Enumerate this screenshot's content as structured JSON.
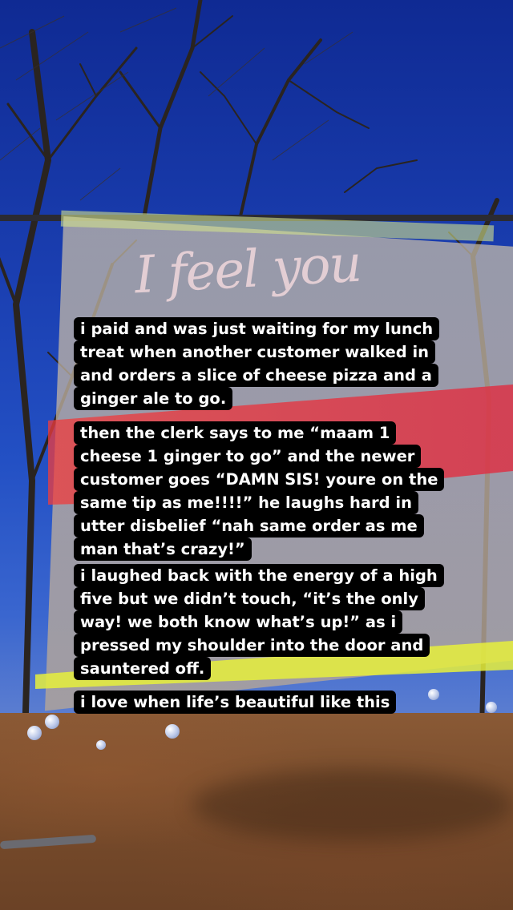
{
  "scene": {
    "description_icons": [
      "tree-silhouette",
      "fabric-banner",
      "glass-bead"
    ],
    "colors": {
      "sky": "#1a3eb0",
      "ground": "#7a4d2c",
      "banner_red": "#e03c46",
      "banner_yellow": "#e6f03c",
      "caption_bg": "#000000",
      "caption_text": "#ffffff"
    }
  },
  "banner": {
    "script_text": "I feel you"
  },
  "captions": [
    {
      "lines": [
        "i paid and was just waiting for my lunch",
        "treat when another customer walked in",
        "and orders a slice of cheese pizza and a",
        "ginger ale to go."
      ]
    },
    {
      "lines": [
        "then the clerk says to me “maam 1",
        "cheese 1 ginger to go” and the newer",
        "customer goes “DAMN SIS! youre on the",
        "same tip as me!!!!” he laughs hard in",
        "utter disbelief “nah same order as me",
        "man that’s crazy!”"
      ]
    },
    {
      "lines": [
        "i laughed back with the energy of a high",
        "five but we didn’t touch, “it’s the only",
        "way! we both know what’s up!” as i",
        "pressed my shoulder into the door and",
        "sauntered off."
      ]
    },
    {
      "lines": [
        "i love when life’s beautiful like this"
      ]
    }
  ]
}
